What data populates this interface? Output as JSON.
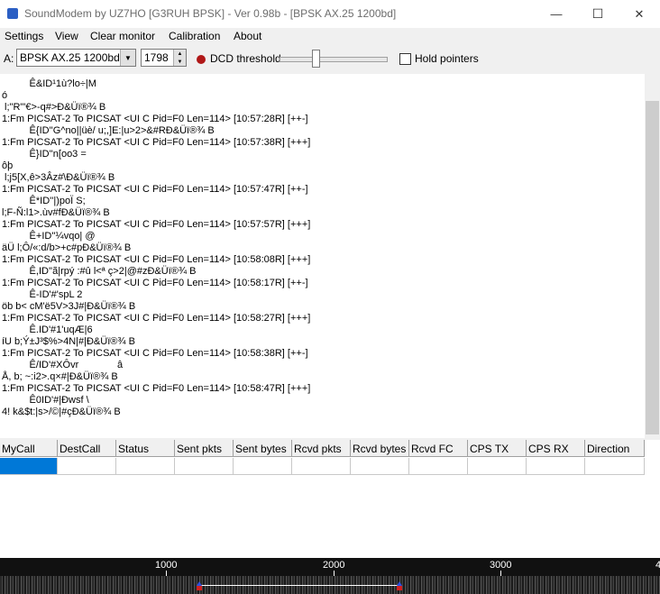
{
  "window": {
    "title": "SoundModem by UZ7HO [G3RUH BPSK] - Ver 0.98b - [BPSK AX.25 1200bd]",
    "minimize": "—",
    "maximize": "☐",
    "close": "✕"
  },
  "menu": [
    "Settings",
    "View",
    "Clear monitor",
    "Calibration",
    "About"
  ],
  "toolbar": {
    "channel_label": "A:",
    "modem_value": "BPSK AX.25 1200bd",
    "frequency_value": "1798",
    "dcd_label": "DCD threshold",
    "dcd_led_color": "#b01818",
    "hold_pointers_label": "Hold pointers",
    "hold_pointers_checked": false
  },
  "monitor": {
    "lines": [
      "          Ê&ID¹1ù?lo÷|M",
      "ó",
      " l;\"R\"'€>-q#>Ð&Üï®¾ B",
      "1:Fm PICSAT-2 To PICSAT <UI C Pid=F0 Len=114> [10:57:28R] [++-]",
      "          Ê{ID''G^no||üè/ u;,]E:|u>2>&#RÐ&Üï®¾ B",
      "1:Fm PICSAT-2 To PICSAT <UI C Pid=F0 Len=114> [10:57:38R] [+++]",
      "          Ê}ID''n[oo3 =",
      "ôþ",
      " l;j5[X,ê>3Âz#\\Ð&Üï®¾ B",
      "1:Fm PICSAT-2 To PICSAT <UI C Pid=F0 Len=114> [10:57:47R] [++-]",
      "          Ê*ID''|)poÏ S;",
      "l;F-Ñ:l1>.ùv#fÐ&Üï®¾ B",
      "1:Fm PICSAT-2 To PICSAT <UI C Pid=F0 Len=114> [10:57:57R] [+++]",
      "          Ê+ID''¼vqo| @",
      "äÜ l;Ô/«:d/b>+c#pÐ&Üï®¾ B",
      "1:Fm PICSAT-2 To PICSAT <UI C Pid=F0 Len=114> [10:58:08R] [+++]",
      "          Ê,ID''ã|rpý :#û l<ª ç>2|@#zÐ&Üï®¾ B",
      "1:Fm PICSAT-2 To PICSAT <UI C Pid=F0 Len=114> [10:58:17R] [++-]",
      "          Ê-ID'#'spL 2",
      "öb b< cM'ë5V>3J#|Ð&Üï®¾ B",
      "1:Fm PICSAT-2 To PICSAT <UI C Pid=F0 Len=114> [10:58:27R] [+++]",
      "          Ê.ID'#1'uqÆ|6",
      "íU b;Ý±J³$%>4N|#|Ð&Üï®¾ B",
      "1:Fm PICSAT-2 To PICSAT <UI C Pid=F0 Len=114> [10:58:38R] [++-]",
      "          Ê/ID'#XÔvr              â",
      "Å, b; ~:i2>.q×#|Ð&Üï®¾ B",
      "1:Fm PICSAT-2 To PICSAT <UI C Pid=F0 Len=114> [10:58:47R] [+++]",
      "          Ê0ID'#|Ðwsf \\",
      "4! k&$t:|s>/©|#çÐ&Üï®¾ B"
    ]
  },
  "table": {
    "columns": [
      "MyCall",
      "DestCall",
      "Status",
      "Sent pkts",
      "Sent bytes",
      "Rcvd pkts",
      "Rcvd bytes",
      "Rcvd FC",
      "CPS TX",
      "CPS RX",
      "Direction"
    ],
    "selected_cell_color": "#0078d7"
  },
  "waterfall": {
    "ticks": [
      "1000",
      "2000",
      "3000",
      "4"
    ],
    "marker_color": "#3050e0"
  }
}
